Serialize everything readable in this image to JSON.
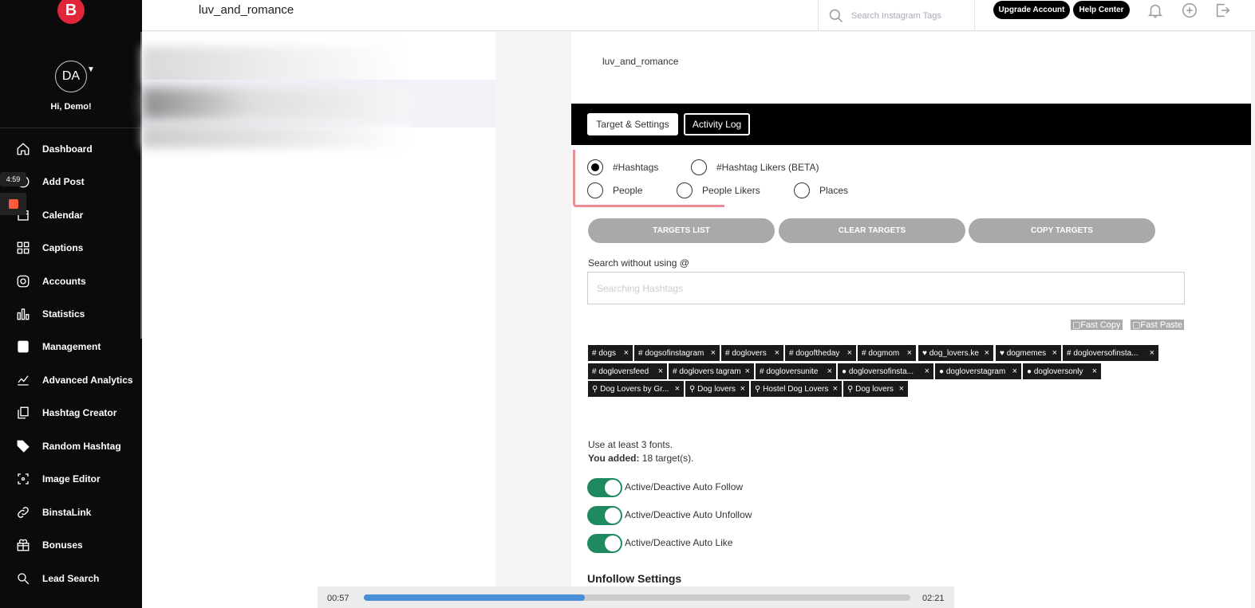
{
  "brand": {
    "logo_letter": "B"
  },
  "user": {
    "initials": "DA",
    "greeting": "Hi, Demo!"
  },
  "recording": {
    "timer": "4:59"
  },
  "nav": [
    {
      "label": "Dashboard",
      "icon": "home-icon"
    },
    {
      "label": "Add Post",
      "icon": "plus-circle-icon"
    },
    {
      "label": "Calendar",
      "icon": "calendar-icon"
    },
    {
      "label": "Captions",
      "icon": "grid-icon"
    },
    {
      "label": "Accounts",
      "icon": "instagram-icon"
    },
    {
      "label": "Statistics",
      "icon": "bar-chart-icon"
    },
    {
      "label": "Management",
      "icon": "badge-icon"
    },
    {
      "label": "Advanced Analytics",
      "icon": "line-chart-icon"
    },
    {
      "label": "Hashtag Creator",
      "icon": "copy-icon"
    },
    {
      "label": "Random Hashtag",
      "icon": "tags-icon"
    },
    {
      "label": "Image Editor",
      "icon": "crop-icon"
    },
    {
      "label": "BinstaLink",
      "icon": "link-icon"
    },
    {
      "label": "Bonuses",
      "icon": "gift-icon"
    },
    {
      "label": "Lead Search",
      "icon": "search-user-icon"
    }
  ],
  "header": {
    "title": "luv_and_romance",
    "search_placeholder": "Search Instagram Tags",
    "upgrade_label": "Upgrade Account",
    "help_label": "Help Center"
  },
  "main": {
    "account_name": "luv_and_romance",
    "tabs": {
      "settings": "Target & Settings",
      "log": "Activity Log"
    },
    "targets": {
      "hashtags": "#Hashtags",
      "hashtag_likers": "#Hashtag Likers (BETA)",
      "people": "People",
      "people_likers": "People Likers",
      "places": "Places",
      "selected": "hashtags"
    },
    "buttons": {
      "list": "TARGETS LIST",
      "clear": "CLEAR TARGETS",
      "copy": "COPY TARGETS"
    },
    "search_label": "Search without using @",
    "search_placeholder": "Searching Hashtags",
    "fast_copy": "Fast Copy",
    "fast_paste": "Fast Paste",
    "tags": [
      {
        "prefix": "#",
        "text": "dogs"
      },
      {
        "prefix": "#",
        "text": "dogsofinstagram"
      },
      {
        "prefix": "#",
        "text": "doglovers"
      },
      {
        "prefix": "#",
        "text": "dogoftheday"
      },
      {
        "prefix": "#",
        "text": "dogmom"
      },
      {
        "prefix": "♥",
        "text": "dog_lovers.ke"
      },
      {
        "prefix": "♥",
        "text": "dogmemes"
      },
      {
        "prefix": "#",
        "text": "dogloversofinsta..."
      },
      {
        "prefix": "#",
        "text": "dogloversfeed"
      },
      {
        "prefix": "#",
        "text": "doglovers tagram"
      },
      {
        "prefix": "#",
        "text": "dogloversunite"
      },
      {
        "prefix": "●",
        "text": "dogloversofinsta..."
      },
      {
        "prefix": "●",
        "text": "dogloverstagram"
      },
      {
        "prefix": "●",
        "text": "dogloversonly"
      },
      {
        "prefix": "⚲",
        "text": "Dog Lovers by Gr..."
      },
      {
        "prefix": "⚲",
        "text": "Dog lovers"
      },
      {
        "prefix": "⚲",
        "text": "Hostel Dog Lovers"
      },
      {
        "prefix": "⚲",
        "text": "Dog lovers"
      }
    ],
    "hint": "Use at least 3 fonts.",
    "added_label": "You added:",
    "added_value": "18 target(s).",
    "toggles": [
      {
        "label": "Active/Deactive Auto Follow",
        "on": true
      },
      {
        "label": "Active/Deactive Auto Unfollow",
        "on": true
      },
      {
        "label": "Active/Deactive Auto Like",
        "on": true
      }
    ],
    "section_title": "Unfollow Settings"
  },
  "video": {
    "current": "00:57",
    "total": "02:21",
    "progress": 0.405
  }
}
